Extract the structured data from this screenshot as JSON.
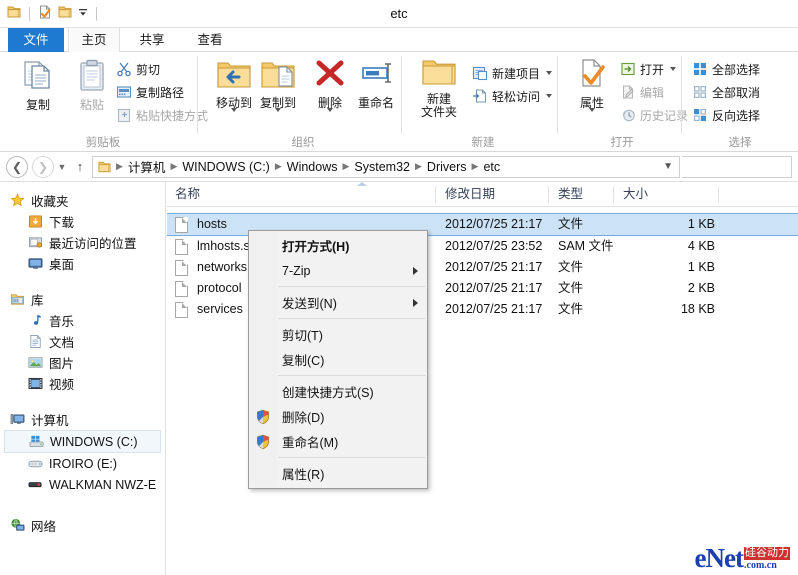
{
  "window": {
    "title": "etc"
  },
  "quick_access": {
    "items": [
      {
        "name": "folder-icon",
        "label": "文件夹"
      },
      {
        "name": "properties-icon",
        "label": "属性"
      },
      {
        "name": "new-folder-icon",
        "label": "新建文件夹"
      },
      {
        "name": "customize-dropdown-icon",
        "label": "自定义快速访问工具栏"
      }
    ]
  },
  "tabs": [
    {
      "id": "file",
      "label": "文件",
      "active": false,
      "file_tab": true
    },
    {
      "id": "home",
      "label": "主页",
      "active": true
    },
    {
      "id": "share",
      "label": "共享",
      "active": false
    },
    {
      "id": "view",
      "label": "查看",
      "active": false
    }
  ],
  "ribbon": {
    "groups": [
      {
        "id": "clipboard",
        "label": "剪贴板",
        "big": [
          {
            "label": "复制",
            "icon": "copy-icon",
            "disabled": false
          },
          {
            "label": "粘贴",
            "icon": "paste-icon",
            "disabled": true
          }
        ],
        "small": [
          {
            "label": "剪切",
            "icon": "scissors-icon",
            "disabled": false
          },
          {
            "label": "复制路径",
            "icon": "copy-path-icon",
            "disabled": false
          },
          {
            "label": "粘贴快捷方式",
            "icon": "paste-shortcut-icon",
            "disabled": true
          }
        ]
      },
      {
        "id": "organize",
        "label": "组织",
        "big": [
          {
            "label": "移动到",
            "icon": "move-to-icon",
            "caret": true
          },
          {
            "label": "复制到",
            "icon": "copy-to-icon",
            "caret": true
          },
          {
            "label": "删除",
            "icon": "delete-icon",
            "caret": true
          },
          {
            "label": "重命名",
            "icon": "rename-icon",
            "caret": false
          }
        ]
      },
      {
        "id": "new",
        "label": "新建",
        "big": [
          {
            "label": "新建\n文件夹",
            "line1": "新建",
            "line2": "文件夹",
            "icon": "new-folder-icon"
          }
        ],
        "small": [
          {
            "label": "新建项目",
            "icon": "new-item-icon",
            "caret": true
          },
          {
            "label": "轻松访问",
            "icon": "easy-access-icon",
            "caret": true
          }
        ]
      },
      {
        "id": "open",
        "label": "打开",
        "big": [
          {
            "label": "属性",
            "icon": "properties-icon",
            "caret": true
          }
        ],
        "small": [
          {
            "label": "打开",
            "icon": "open-icon",
            "caret": true,
            "disabled": false
          },
          {
            "label": "编辑",
            "icon": "edit-icon",
            "disabled": true
          },
          {
            "label": "历史记录",
            "icon": "history-icon",
            "disabled": true
          }
        ]
      },
      {
        "id": "select",
        "label": "选择",
        "small": [
          {
            "label": "全部选择",
            "icon": "select-all-icon"
          },
          {
            "label": "全部取消",
            "icon": "select-none-icon"
          },
          {
            "label": "反向选择",
            "icon": "invert-selection-icon"
          }
        ]
      }
    ]
  },
  "address_bar": {
    "back_label": "后退",
    "forward_label": "前进",
    "recent_label": "最近位置",
    "up_label": "上移一级",
    "crumbs": [
      "计算机",
      "WINDOWS (C:)",
      "Windows",
      "System32",
      "Drivers",
      "etc"
    ],
    "search_placeholder": ""
  },
  "nav_pane": {
    "items": [
      {
        "label": "收藏夹",
        "icon": "favorites-star-icon",
        "level": 1
      },
      {
        "label": "下载",
        "icon": "downloads-icon",
        "level": 2
      },
      {
        "label": "最近访问的位置",
        "icon": "recent-places-icon",
        "level": 2
      },
      {
        "label": "桌面",
        "icon": "desktop-icon",
        "level": 2
      },
      {
        "gap": true
      },
      {
        "label": "库",
        "icon": "library-icon",
        "level": 1
      },
      {
        "label": "音乐",
        "icon": "music-icon",
        "level": 2
      },
      {
        "label": "文档",
        "icon": "documents-icon",
        "level": 2
      },
      {
        "label": "图片",
        "icon": "pictures-icon",
        "level": 2
      },
      {
        "label": "视频",
        "icon": "videos-icon",
        "level": 2
      },
      {
        "gap": true
      },
      {
        "label": "计算机",
        "icon": "computer-icon",
        "level": 1
      },
      {
        "label": "WINDOWS (C:)",
        "icon": "local-disk-icon",
        "level": 2,
        "selected": true
      },
      {
        "label": "IROIRO (E:)",
        "icon": "removable-disk-icon",
        "level": 2
      },
      {
        "label": "WALKMAN NWZ-E",
        "icon": "portable-device-icon",
        "level": 2
      },
      {
        "gap": true
      },
      {
        "label": "网络",
        "icon": "network-icon",
        "level": 1
      }
    ]
  },
  "file_list": {
    "columns": [
      {
        "key": "name",
        "label": "名称",
        "sorted": true
      },
      {
        "key": "date",
        "label": "修改日期"
      },
      {
        "key": "type",
        "label": "类型"
      },
      {
        "key": "size",
        "label": "大小"
      }
    ],
    "rows": [
      {
        "name": "hosts",
        "date": "2012/07/25 21:17",
        "type": "文件",
        "size": "1 KB",
        "selected": true
      },
      {
        "name": "lmhosts.sam",
        "date": "2012/07/25 23:52",
        "type": "SAM 文件",
        "size": "4 KB",
        "selected": false
      },
      {
        "name": "networks",
        "date": "2012/07/25 21:17",
        "type": "文件",
        "size": "1 KB",
        "selected": false
      },
      {
        "name": "protocol",
        "date": "2012/07/25 21:17",
        "type": "文件",
        "size": "2 KB",
        "selected": false
      },
      {
        "name": "services",
        "date": "2012/07/25 21:17",
        "type": "文件",
        "size": "18 KB",
        "selected": false
      }
    ]
  },
  "context_menu": {
    "items": [
      {
        "label": "打开方式(H)",
        "bold": true
      },
      {
        "label": "7-Zip",
        "submenu": true
      },
      {
        "separator": true
      },
      {
        "label": "发送到(N)",
        "submenu": true
      },
      {
        "separator": true
      },
      {
        "label": "剪切(T)"
      },
      {
        "label": "复制(C)"
      },
      {
        "separator": true
      },
      {
        "label": "创建快捷方式(S)"
      },
      {
        "label": "删除(D)",
        "shield": true
      },
      {
        "label": "重命名(M)",
        "shield": true
      },
      {
        "separator": true
      },
      {
        "label": "属性(R)"
      }
    ]
  },
  "watermark": {
    "e": "e",
    "net": "Net",
    "cn_top": "硅谷动力",
    "cn_bottom": ".com.cn"
  },
  "colors": {
    "accent_blue": "#1e7ad0",
    "selection_fill": "#cce3f7",
    "selection_border": "#7aacdd",
    "header_text": "#35425a",
    "watermark_blue": "#1b3fae",
    "watermark_red": "#d03030"
  }
}
